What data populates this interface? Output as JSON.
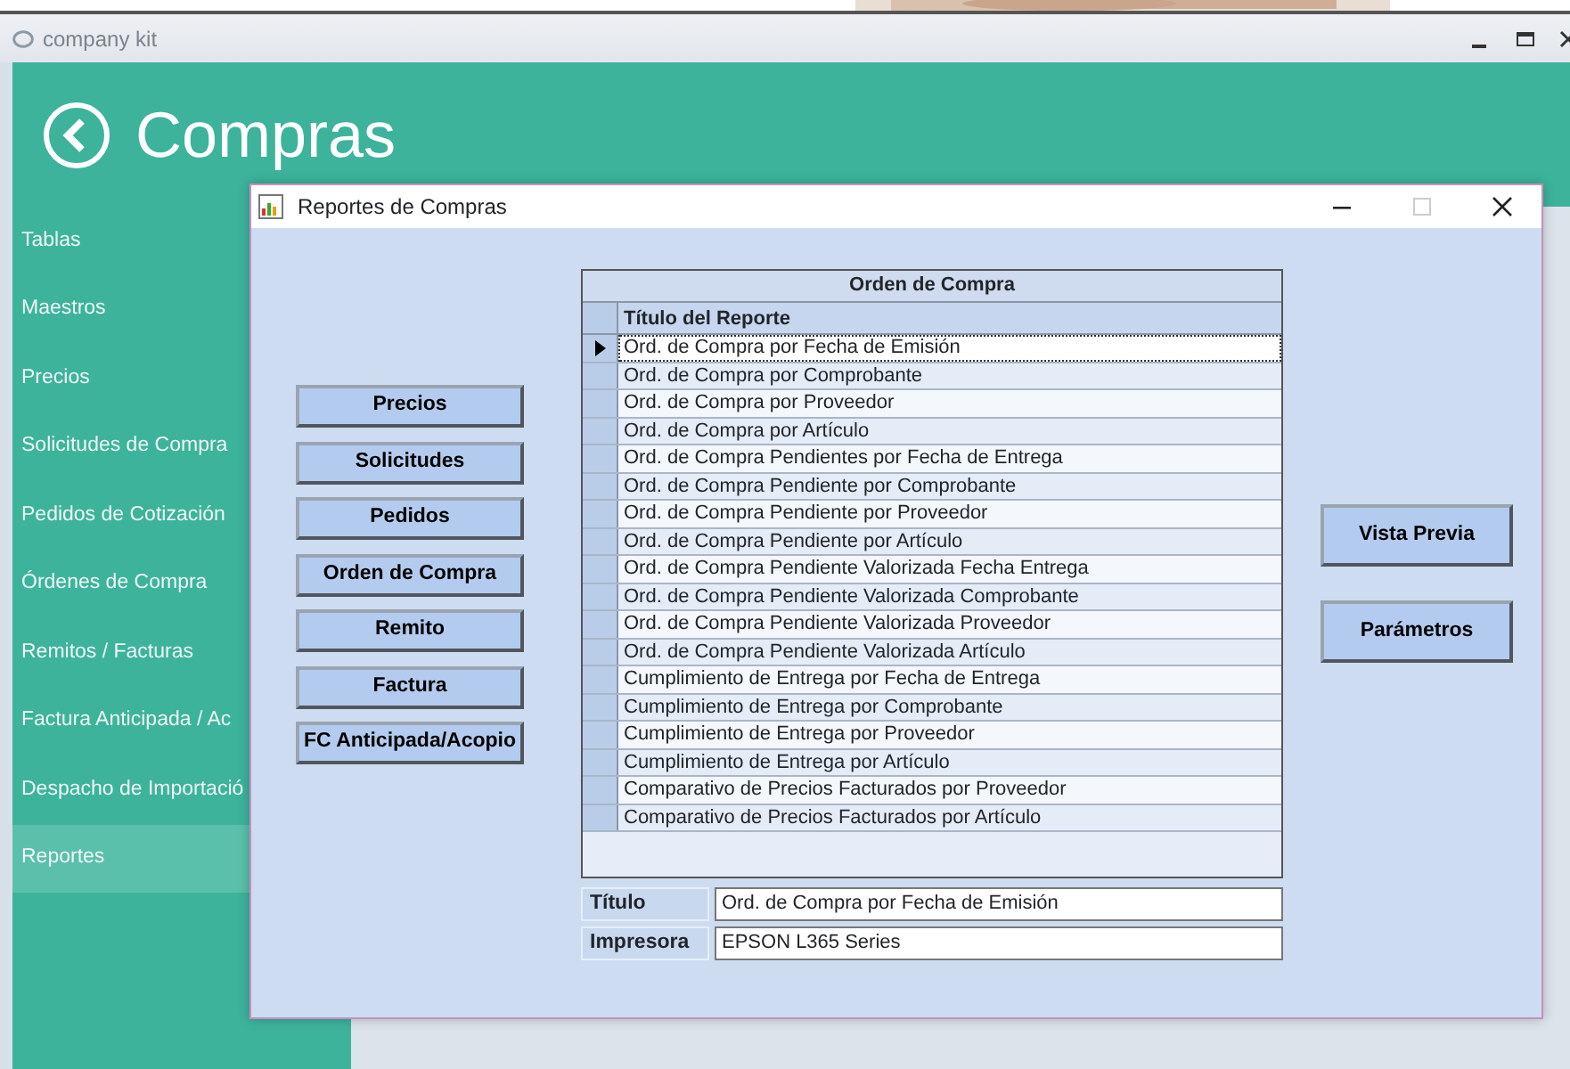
{
  "app": {
    "title": "company kit"
  },
  "header": {
    "title": "Compras"
  },
  "sidebar": {
    "items": [
      {
        "label": "Tablas",
        "selected": false
      },
      {
        "label": "Maestros",
        "selected": false
      },
      {
        "label": "Precios",
        "selected": false
      },
      {
        "label": "Solicitudes de Compra",
        "selected": false
      },
      {
        "label": "Pedidos de Cotización",
        "selected": false
      },
      {
        "label": "Órdenes de Compra",
        "selected": false
      },
      {
        "label": "Remitos / Facturas",
        "selected": false
      },
      {
        "label": "Factura Anticipada / Ac",
        "selected": false
      },
      {
        "label": "Despacho de Importació",
        "selected": false
      },
      {
        "label": "Reportes",
        "selected": true
      }
    ]
  },
  "dialog": {
    "title": "Reportes de Compras",
    "categories": [
      "Precios",
      "Solicitudes",
      "Pedidos",
      "Orden de Compra",
      "Remito",
      "Factura",
      "FC Anticipada/Acopio"
    ],
    "grid": {
      "group_title": "Orden de Compra",
      "columns": [
        "Título del Reporte"
      ],
      "rows": [
        {
          "title": "Ord. de Compra por Fecha de Emisión",
          "selected": true
        },
        {
          "title": "Ord. de Compra por Comprobante",
          "selected": false
        },
        {
          "title": "Ord. de Compra por Proveedor",
          "selected": false
        },
        {
          "title": "Ord. de Compra por Artículo",
          "selected": false
        },
        {
          "title": "Ord. de Compra Pendientes por Fecha de Entrega",
          "selected": false
        },
        {
          "title": "Ord. de Compra Pendiente por Comprobante",
          "selected": false
        },
        {
          "title": "Ord. de Compra Pendiente por Proveedor",
          "selected": false
        },
        {
          "title": "Ord. de Compra Pendiente por Artículo",
          "selected": false
        },
        {
          "title": "Ord. de Compra Pendiente Valorizada Fecha Entrega",
          "selected": false
        },
        {
          "title": "Ord. de Compra Pendiente Valorizada Comprobante",
          "selected": false
        },
        {
          "title": "Ord. de Compra Pendiente Valorizada Proveedor",
          "selected": false
        },
        {
          "title": "Ord. de Compra Pendiente Valorizada Artículo",
          "selected": false
        },
        {
          "title": "Cumplimiento de Entrega por Fecha de Entrega",
          "selected": false
        },
        {
          "title": "Cumplimiento de Entrega por Comprobante",
          "selected": false
        },
        {
          "title": "Cumplimiento de Entrega por Proveedor",
          "selected": false
        },
        {
          "title": "Cumplimiento de Entrega por Artículo",
          "selected": false
        },
        {
          "title": "Comparativo de Precios Facturados por Proveedor",
          "selected": false
        },
        {
          "title": "Comparativo de Precios Facturados por Artículo",
          "selected": false
        }
      ]
    },
    "fields": [
      {
        "label": "Título",
        "value": "Ord. de Compra por Fecha de Emisión"
      },
      {
        "label": "Impresora",
        "value": "EPSON L365 Series"
      }
    ],
    "actions": [
      "Vista Previa",
      "Parámetros"
    ]
  }
}
